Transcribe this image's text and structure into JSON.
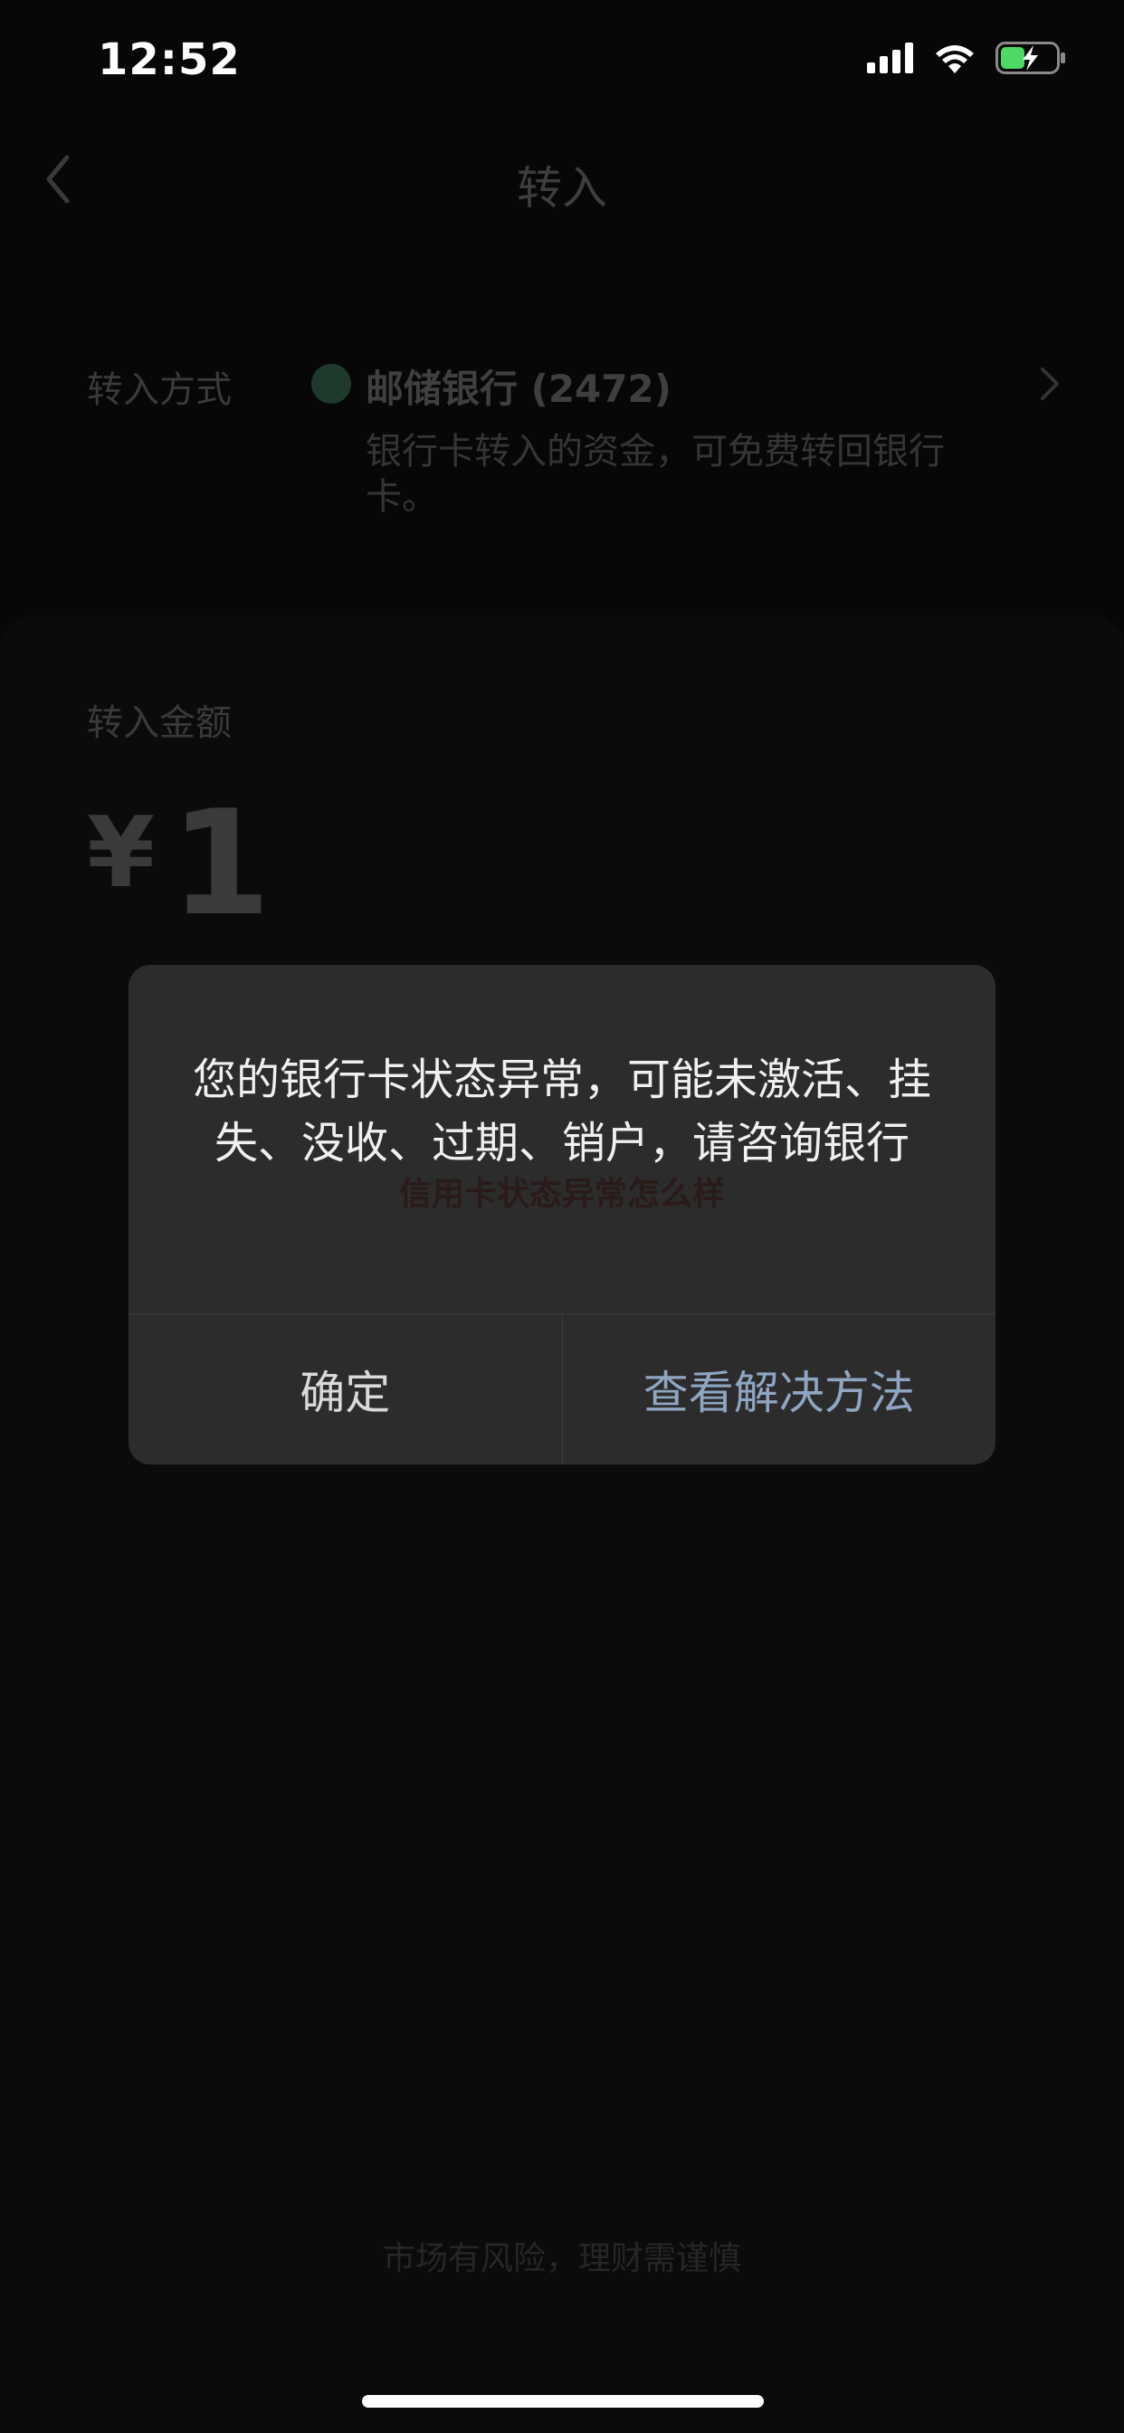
{
  "status_bar": {
    "time": "12:52",
    "icons": [
      "signal-icon",
      "wifi-icon",
      "battery-charging-icon"
    ]
  },
  "nav": {
    "back_icon": "chevron-left-icon",
    "title": "转入"
  },
  "transfer_method": {
    "label": "转入方式",
    "bank_icon": "postal-bank-logo-icon",
    "bank_name": "邮储银行 (2472)",
    "description": "银行卡转入的资金，可免费转回银行卡。",
    "chevron_icon": "chevron-right-icon"
  },
  "amount": {
    "label": "转入金额",
    "currency": "¥",
    "value": "1"
  },
  "watermark": "信用卡状态异常怎么样",
  "dialog": {
    "message": "您的银行卡状态异常，可能未激活、挂失、没收、过期、销户，请咨询银行",
    "confirm_label": "确定",
    "solution_label": "查看解决方法"
  },
  "footer": {
    "risk_note": "市场有风险，理财需谨慎"
  },
  "colors": {
    "background": "#070707",
    "dialog_bg": "#2c2c2c",
    "link_blue": "#8fa6c2"
  }
}
